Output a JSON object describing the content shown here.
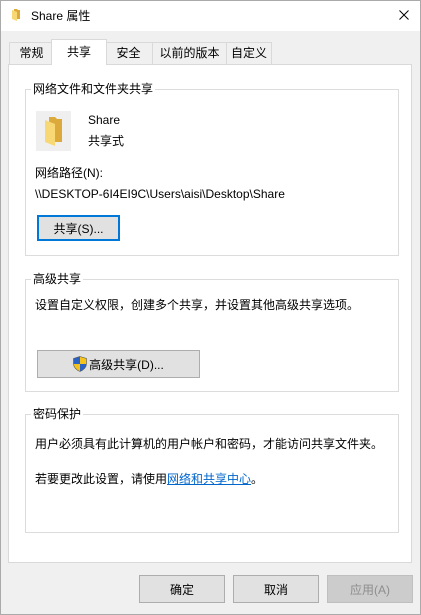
{
  "window": {
    "title": "Share 属性"
  },
  "icons": {
    "title_icon": "folder-icon",
    "close": "close-icon",
    "shared_folder": "shared-folder-icon",
    "advanced_button": "uac-shield-icon"
  },
  "colors": {
    "link": "#0066cc",
    "focus_border": "#0078d7",
    "folder_front": "#f8d775",
    "folder_back": "#dcaa3a",
    "shield_blue": "#2a63c5",
    "shield_yellow": "#f6c21c",
    "disabled_text": "#8d8d8d"
  },
  "tabs": [
    {
      "label": "常规",
      "selected": false
    },
    {
      "label": "共享",
      "selected": true
    },
    {
      "label": "安全",
      "selected": false
    },
    {
      "label": "以前的版本",
      "selected": false
    },
    {
      "label": "自定义",
      "selected": false
    }
  ],
  "network_sharing": {
    "group_label": "网络文件和文件夹共享",
    "folder_name": "Share",
    "share_state": "共享式",
    "path_label": "网络路径(N):",
    "path": "\\\\DESKTOP-6I4EI9C\\Users\\aisi\\Desktop\\Share",
    "share_button": "共享(S)..."
  },
  "advanced_sharing": {
    "group_label": "高级共享",
    "description": "设置自定义权限，创建多个共享，并设置其他高级共享选项。",
    "button": "高级共享(D)..."
  },
  "password_protection": {
    "group_label": "密码保护",
    "description": "用户必须具有此计算机的用户帐户和密码，才能访问共享文件夹。",
    "change_text_before": "若要更改此设置，请使用",
    "change_link": "网络和共享中心",
    "change_text_after": "。"
  },
  "footer": {
    "ok": "确定",
    "cancel": "取消",
    "apply": "应用(A)",
    "apply_enabled": false
  }
}
